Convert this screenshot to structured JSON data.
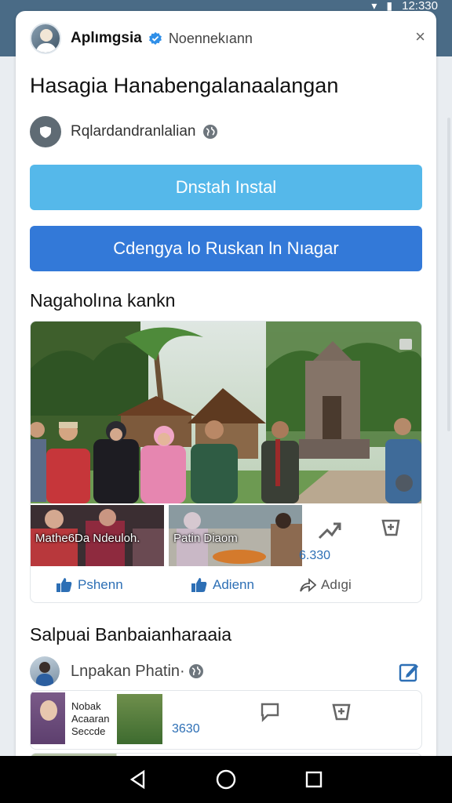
{
  "status_bar": {
    "time": "12:330"
  },
  "header": {
    "app_name": "Aplımgsia",
    "subtitle": "Noennekıann",
    "close_glyph": "×"
  },
  "title": "Hasagia Hanabengalanaalangan",
  "location": {
    "text": "Rqlardandranlalian"
  },
  "buttons": {
    "primary": "Dnstah Instal",
    "secondary": "Cdengya lo Ruskan ln Nıagar"
  },
  "section1": {
    "heading": "Nagaholına kankn",
    "post": {
      "thumbs": [
        {
          "label": "Mathe6Da Ndeuloh."
        },
        {
          "label": "Patin Diaom"
        }
      ],
      "count": "6.330",
      "actions": [
        {
          "label": "Pshenn",
          "icon": "like-icon"
        },
        {
          "label": "Adienn",
          "icon": "like-icon"
        },
        {
          "label": "Adıgi",
          "icon": "share-icon"
        }
      ]
    }
  },
  "section2": {
    "heading": "Salpuai Banbaianharaaia",
    "author": "Lnpakan Phatin·",
    "post": {
      "text_lines": [
        "Nobak",
        "Acaaran",
        "Seccde"
      ],
      "count": "3630"
    }
  },
  "colors": {
    "status_bar": "#4a6b86",
    "btn_primary": "#55b8ea",
    "btn_secondary": "#3379d8",
    "link_blue": "#2d6fb5"
  }
}
